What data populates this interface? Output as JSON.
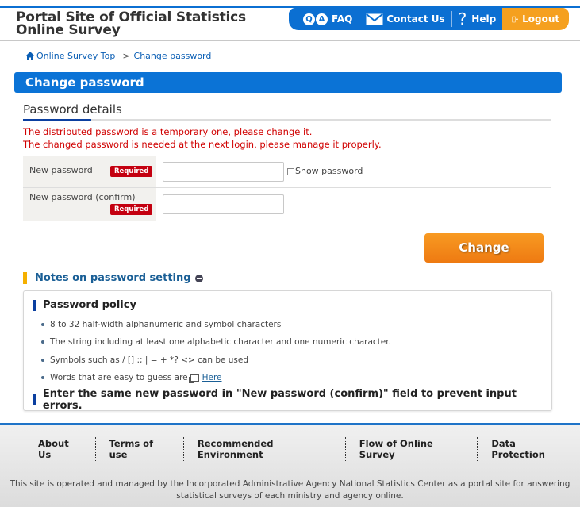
{
  "header": {
    "title_line1": "Portal Site of Official Statistics",
    "title_line2": "Online Survey",
    "nav": {
      "faq_icon_q": "Q",
      "faq_icon_a": "A",
      "faq": "FAQ",
      "contact": "Contact Us",
      "help": "Help",
      "logout": "Logout"
    }
  },
  "breadcrumb": {
    "home": "Online Survey Top",
    "separator": ">",
    "current": "Change password"
  },
  "page_title": "Change password",
  "section": {
    "title": "Password details",
    "warnings": [
      "The distributed password is a temporary one, please change it.",
      "The changed password is needed at the next login, please manage it properly."
    ]
  },
  "form": {
    "new_password_label": "New password",
    "confirm_label": "New password (confirm)",
    "required_badge": "Required",
    "new_password_value": "",
    "confirm_value": "",
    "show_password_label": "Show password",
    "show_password_checked": false,
    "change_button": "Change"
  },
  "notes": {
    "heading": "Notes on password setting",
    "policy_title": "Password policy",
    "items": [
      "8 to 32 half-width alphanumeric and symbol characters",
      "The string including at least one alphabetic character and one numeric character.",
      "Symbols such as / [] :; | = + *? <> can be used",
      "Words that are easy to guess are"
    ],
    "here_link": "Here",
    "enter_note": "Enter the same new password in \"New password (confirm)\" field to prevent input errors."
  },
  "footer": {
    "links": [
      "About Us",
      "Terms of use",
      "Recommended Environment",
      "Flow of Online Survey",
      "Data Protection"
    ],
    "note": "This site is operated and managed by the Incorporated Administrative Agency National Statistics Center as a portal site for answering statistical surveys of each ministry and agency online."
  },
  "colors": {
    "brand_blue": "#0b73d6",
    "logout_orange": "#f5a01f",
    "warning_red": "#d00000",
    "required_red": "#c40010",
    "change_orange": "#f08a1a"
  }
}
